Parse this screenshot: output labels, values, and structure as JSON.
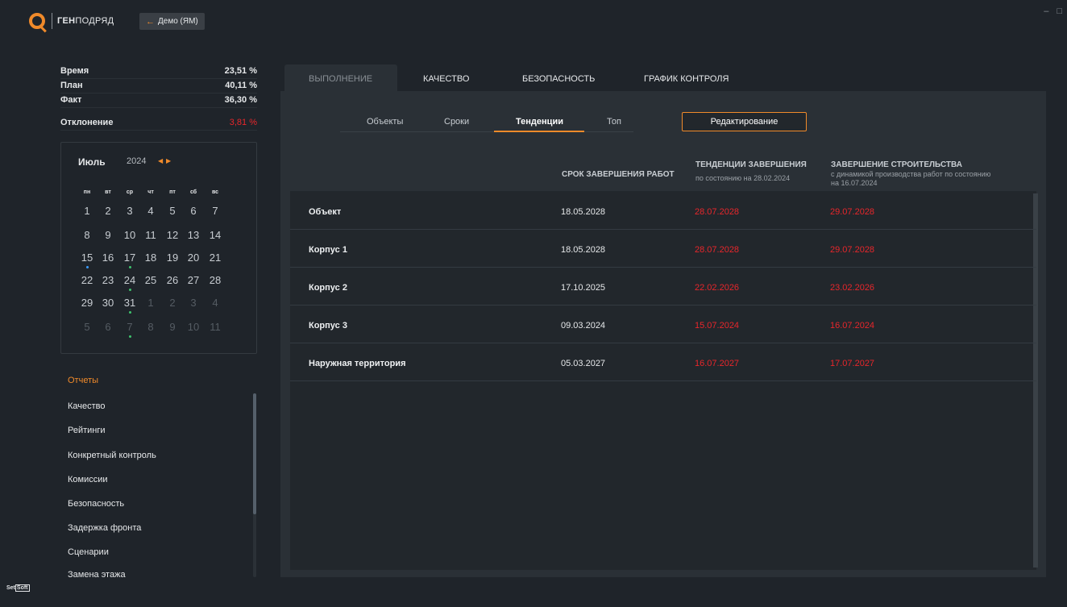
{
  "app": {
    "brand_bold": "ГЕН",
    "brand_rest": "ПОДРЯД",
    "back_label": "Демо (ЯМ)",
    "window_controls": [
      "–",
      "□"
    ],
    "footer_logo": "Set",
    "footer_logo_box": "Soft"
  },
  "stats": [
    {
      "label": "Время",
      "value": "23,51 %"
    },
    {
      "label": "План",
      "value": "40,11 %"
    },
    {
      "label": "Факт",
      "value": "36,30 %"
    },
    {
      "label": "Отклонение",
      "value": "3,81 %"
    }
  ],
  "calendar": {
    "month": "Июль",
    "year": "2024",
    "dow": [
      "пн",
      "вт",
      "ср",
      "чт",
      "пт",
      "сб",
      "вс"
    ],
    "weeks": [
      [
        "1",
        "2",
        "3",
        "4",
        "5",
        "6",
        "7"
      ],
      [
        "8",
        "9",
        "10",
        "11",
        "12",
        "13",
        "14"
      ],
      [
        "15",
        "16",
        "17",
        "18",
        "19",
        "20",
        "21"
      ],
      [
        "22",
        "23",
        "24",
        "25",
        "26",
        "27",
        "28"
      ],
      [
        "29",
        "30",
        "31",
        "1",
        "2",
        "3",
        "4"
      ],
      [
        "5",
        "6",
        "7",
        "8",
        "9",
        "10",
        "11"
      ]
    ]
  },
  "reports": {
    "title": "Отчеты",
    "items": [
      "Качество",
      "Рейтинги",
      "Конкретный контроль",
      "Комиссии",
      "Безопасность",
      "Задержка фронта",
      "Сценарии",
      "Замена этажа"
    ]
  },
  "main_tabs": [
    "ВЫПОЛНЕНИЕ",
    "КАЧЕСТВО",
    "БЕЗОПАСНОСТЬ",
    "ГРАФИК КОНТРОЛЯ"
  ],
  "sub_tabs": [
    "Объекты",
    "Сроки",
    "Тенденции",
    "Топ"
  ],
  "edit_button": "Редактирование",
  "table": {
    "headers": {
      "col2": "СРОК ЗАВЕРШЕНИЯ РАБОТ",
      "col3": "ТЕНДЕНЦИИ ЗАВЕРШЕНИЯ",
      "col3_sub": "по состоянию на 28.02.2024",
      "col4": "ЗАВЕРШЕНИЕ СТРОИТЕЛЬСТВА",
      "col4_sub1": "с динамикой производства работ по состоянию",
      "col4_sub2": "на 16.07.2024"
    },
    "rows": [
      {
        "name": "Объект",
        "deadline": "18.05.2028",
        "trend": "28.07.2028",
        "completion": "29.07.2028"
      },
      {
        "name": "Корпус 1",
        "deadline": "18.05.2028",
        "trend": "28.07.2028",
        "completion": "29.07.2028"
      },
      {
        "name": "Корпус 2",
        "deadline": "17.10.2025",
        "trend": "22.02.2026",
        "completion": "23.02.2026"
      },
      {
        "name": "Корпус 3",
        "deadline": "09.03.2024",
        "trend": "15.07.2024",
        "completion": "16.07.2024"
      },
      {
        "name": "Наружная территория",
        "deadline": "05.03.2027",
        "trend": "16.07.2027",
        "completion": "17.07.2027"
      }
    ]
  },
  "colors": {
    "accent": "#f08a2a",
    "alert": "#e8262b",
    "dot_blue": "#3a9bff",
    "dot_green": "#3ec46d"
  }
}
